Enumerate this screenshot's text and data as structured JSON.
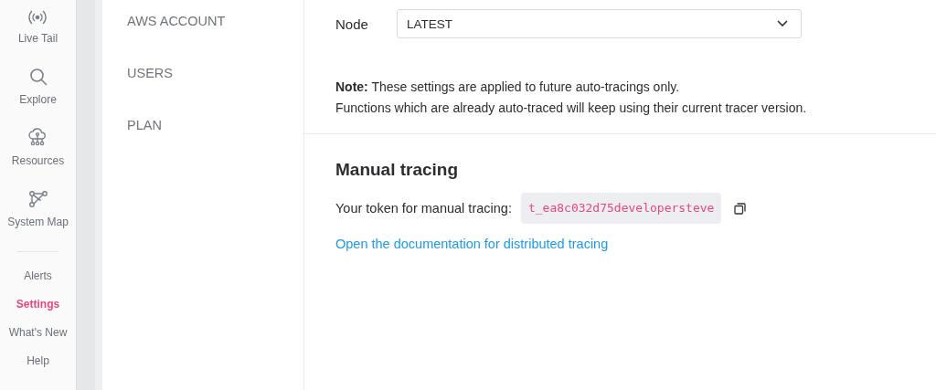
{
  "nav": {
    "icon_items": [
      {
        "kind": "live",
        "label": "Live Tail",
        "selected": false
      },
      {
        "kind": "search",
        "label": "Explore",
        "selected": false
      },
      {
        "kind": "cloud",
        "label": "Resources",
        "selected": false
      },
      {
        "kind": "graph",
        "label": "System Map",
        "selected": false
      }
    ],
    "text_items": [
      {
        "label": "Alerts",
        "selected": false
      },
      {
        "label": "Settings",
        "selected": true
      },
      {
        "label": "What's New",
        "selected": false
      },
      {
        "label": "Help",
        "selected": false
      }
    ]
  },
  "settings_menu": [
    {
      "label": "AWS ACCOUNT",
      "selected": false
    },
    {
      "label": "USERS",
      "selected": false
    },
    {
      "label": "PLAN",
      "selected": false
    }
  ],
  "node": {
    "label": "Node",
    "value": "LATEST"
  },
  "note": "**Note:** These settings are applied to future auto-tracings only.",
  "note_line_2": "Functions which are already auto-traced will keep using their current tracer version.",
  "manual_tracing": {
    "title": "Manual tracing",
    "token_label": "Your token for manual tracing:",
    "token": "t_ea8c032d75developersteve",
    "link": "Open the documentation for distributed tracing"
  }
}
